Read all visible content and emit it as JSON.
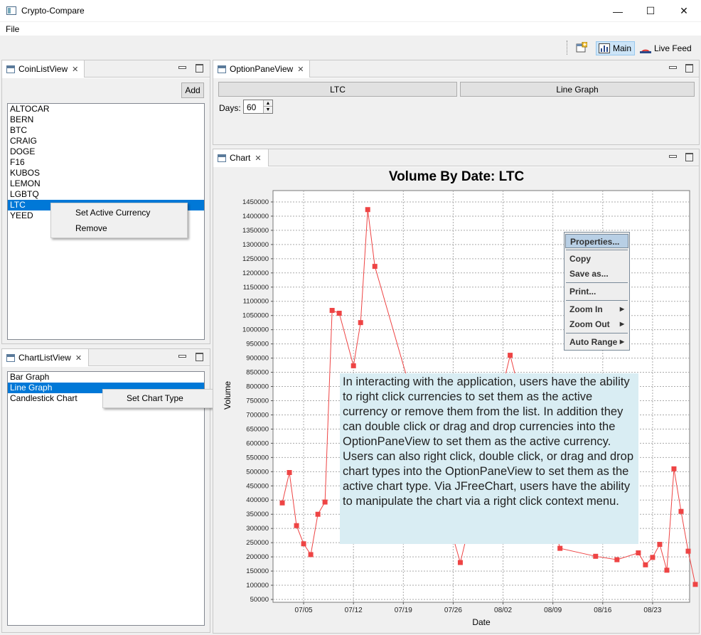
{
  "window": {
    "title": "Crypto-Compare",
    "min_glyph": "—",
    "max_glyph": "☐",
    "close_glyph": "✕"
  },
  "menu": {
    "file": "File"
  },
  "toolbar": {
    "main_label": "Main",
    "live_feed_label": "Live Feed"
  },
  "coin_list_view": {
    "tab": "CoinListView",
    "add_label": "Add",
    "coins": [
      "ALTOCAR",
      "BERN",
      "BTC",
      "CRAIG",
      "DOGE",
      "F16",
      "KUBOS",
      "LEMON",
      "LGBTQ",
      "LTC",
      "YEED"
    ],
    "selected": "LTC",
    "context_menu": {
      "set_active": "Set Active Currency",
      "remove": "Remove"
    }
  },
  "chart_list_view": {
    "tab": "ChartListView",
    "chart_types": [
      "Bar Graph",
      "Line Graph",
      "Candlestick Chart"
    ],
    "selected": "Line Graph",
    "context_menu": {
      "set_type": "Set Chart Type"
    }
  },
  "option_pane_view": {
    "tab": "OptionPaneView",
    "currency_button": "LTC",
    "chart_type_button": "Line Graph",
    "days_label": "Days:",
    "days_value": "60"
  },
  "chart_view": {
    "tab": "Chart",
    "context_menu": {
      "properties": "Properties...",
      "copy": "Copy",
      "save_as": "Save as...",
      "print": "Print...",
      "zoom_in": "Zoom In",
      "zoom_out": "Zoom Out",
      "auto_range": "Auto Range"
    }
  },
  "annotation": {
    "p1": "In interacting with the application, users have the ability to right click currencies to set them as the active currency or remove them from the list. In addition they can double click or drag and drop currencies into the OptionPaneView to set them as the active currency.",
    "p2": "Users can also right click, double click, or drag and drop chart types into the OptionPaneView to set them as the active chart type. Via JFreeChart, users have the ability to manipulate the chart via a right click context menu."
  },
  "chart_data": {
    "type": "line",
    "title": "Volume By Date: LTC",
    "xlabel": "Date",
    "ylabel": "Volume",
    "series_color": "#ee4444",
    "grid": true,
    "ylim": [
      40000,
      1490000
    ],
    "y_ticks": [
      50000,
      100000,
      150000,
      200000,
      250000,
      300000,
      350000,
      400000,
      450000,
      500000,
      550000,
      600000,
      650000,
      700000,
      750000,
      800000,
      850000,
      900000,
      950000,
      1000000,
      1050000,
      1100000,
      1150000,
      1200000,
      1250000,
      1300000,
      1350000,
      1400000,
      1450000
    ],
    "x_ticks": [
      "07/05",
      "07/12",
      "07/19",
      "07/26",
      "08/02",
      "08/09",
      "08/16",
      "08/23"
    ],
    "x_tick_days": [
      4,
      11,
      18,
      25,
      32,
      39,
      46,
      53
    ],
    "x_range": [
      -0.3,
      58.2
    ],
    "points": [
      [
        1,
        390000
      ],
      [
        2,
        497000
      ],
      [
        3,
        310000
      ],
      [
        4,
        246000
      ],
      [
        5,
        208000
      ],
      [
        6,
        350000
      ],
      [
        7,
        393000
      ],
      [
        8,
        1068000
      ],
      [
        9,
        1058000
      ],
      [
        11,
        873000
      ],
      [
        12,
        1025000
      ],
      [
        13,
        1423000
      ],
      [
        14,
        1223000
      ],
      [
        26,
        180000
      ],
      [
        33,
        910000
      ],
      [
        40,
        230000
      ],
      [
        45,
        202000
      ],
      [
        48,
        190000
      ],
      [
        51,
        214000
      ],
      [
        52,
        172000
      ],
      [
        53,
        198000
      ],
      [
        54,
        244000
      ],
      [
        55,
        153000
      ],
      [
        56,
        510000
      ],
      [
        57,
        360000
      ],
      [
        58,
        220000
      ],
      [
        59,
        103000
      ]
    ]
  }
}
